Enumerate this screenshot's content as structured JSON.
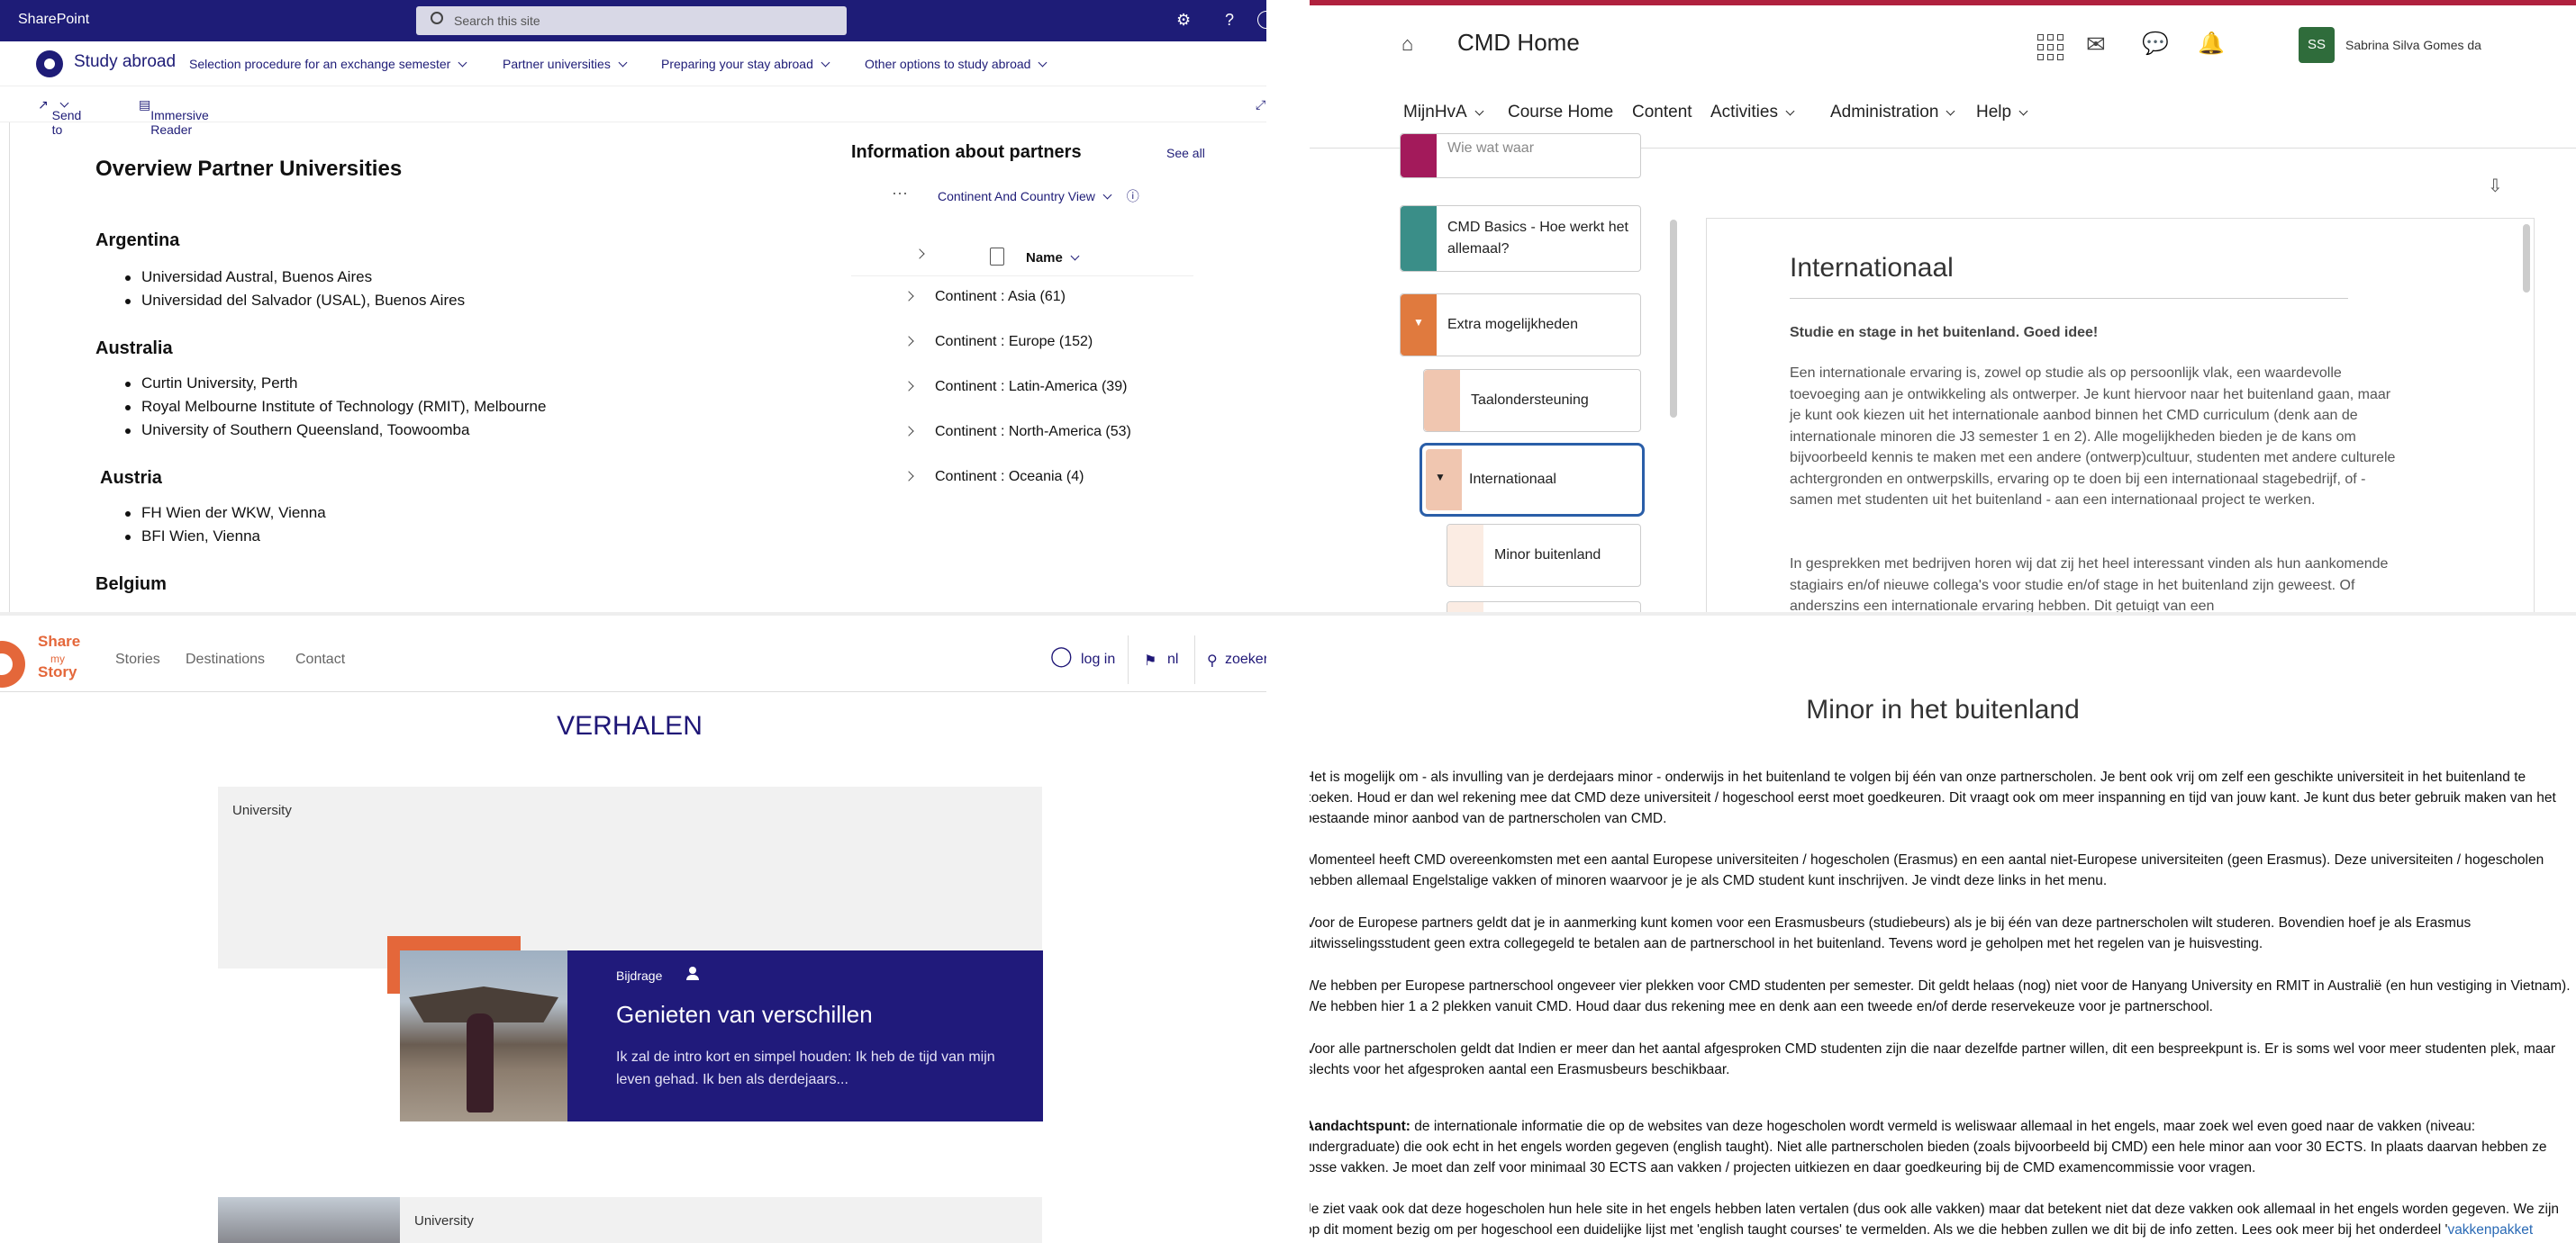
{
  "sharepoint": {
    "brand": "SharePoint",
    "search_placeholder": "Search this site",
    "site_name": "Study abroad",
    "nav": [
      "Selection procedure for an exchange semester",
      "Partner universities",
      "Preparing your stay abroad",
      "Other options to study abroad"
    ],
    "cmd": {
      "send_to": "Send to",
      "immersive_reader": "Immersive Reader"
    },
    "heading": "Overview Partner Universities",
    "countries": [
      {
        "name": "Argentina",
        "unis": [
          "Universidad Austral, Buenos Aires",
          "Universidad del Salvador (USAL), Buenos Aires"
        ]
      },
      {
        "name": "Australia",
        "unis": [
          "Curtin University, Perth",
          "Royal Melbourne Institute of Technology (RMIT), Melbourne",
          "University of Southern Queensland, Toowoomba"
        ]
      },
      {
        "name": "Austria",
        "unis": [
          "FH Wien der WKW, Vienna",
          "BFI Wien, Vienna"
        ]
      },
      {
        "name": "Belgium",
        "unis": []
      }
    ],
    "partners": {
      "title": "Information about partners",
      "see_all": "See all",
      "view": "Continent And Country View",
      "name_header": "Name",
      "groups": [
        "Continent : Asia (61)",
        "Continent : Europe (152)",
        "Continent : Latin-America (39)",
        "Continent : North-America (53)",
        "Continent : Oceania (4)"
      ]
    },
    "colors": {
      "suite_bar": "#1e1c77"
    }
  },
  "cmd": {
    "title": "CMD Home",
    "avatar": "SS",
    "user": "Sabrina Silva Gomes da",
    "nav": [
      "MijnHvA",
      "Course Home",
      "Content",
      "Activities",
      "Administration",
      "Help"
    ],
    "sidebar": {
      "partial_top": "Wie wat waar",
      "basics": "CMD Basics - Hoe werkt het allemaal?",
      "extra": "Extra mogelijkheden",
      "taal": "Taalondersteuning",
      "internationaal": "Internationaal",
      "minor": "Minor buitenland"
    },
    "doc": {
      "heading": "Internationaal",
      "lead": "Studie en stage in het buitenland. Goed idee!",
      "p1": "Een internationale ervaring is, zowel op studie als op persoonlijk vlak, een waardevolle toevoeging aan je ontwikkeling als ontwerper. Je kunt hiervoor naar het buitenland gaan, maar je kunt ook kiezen uit het internationale aanbod binnen het CMD curriculum (denk aan de internationale minoren die J3 semester 1 en 2). Alle mogelijkheden bieden je de kans om bijvoorbeeld kennis te maken met een andere (ontwerp)cultuur, studenten met andere culturele achtergronden en ontwerpskills, ervaring op te doen bij een internationaal stagebedrijf, of - samen met studenten uit het buitenland - aan een internationaal project te werken.",
      "p2": "In gesprekken met bedrijven horen wij dat zij het heel interessant vinden als hun aankomende stagiairs en/of nieuwe collega's voor studie en/of stage in het buitenland zijn geweest. Of anderszins een internationale ervaring hebben. Dit getuigt van een"
    },
    "colors": {
      "brand_bar": "#b0213e",
      "avatar": "#2f6c3b",
      "selected_border": "#2a5ea8"
    }
  },
  "story": {
    "logo": [
      "Share",
      "my",
      "Story"
    ],
    "nav": [
      "Stories",
      "Destinations",
      "Contact"
    ],
    "login": "log in",
    "lang": "nl",
    "search": "zoeker",
    "title": "VERHALEN",
    "card1": {
      "category": "University",
      "tag": "Bijdrage",
      "headline": "Genieten van verschillen",
      "teaser": "Ik zal de intro kort en simpel houden: Ik heb de tijd van mijn leven gehad. Ik ben als derdejaars..."
    },
    "card2": {
      "category": "University"
    },
    "colors": {
      "brand": "#201a7b",
      "accent": "#e4673a"
    }
  },
  "minor": {
    "title": "Minor in het buitenland",
    "p1": "Het is mogelijk om - als invulling van je derdejaars minor - onderwijs in het buitenland te volgen bij één van onze partnerscholen. Je bent ook vrij om zelf een geschikte universiteit in het buitenland te zoeken. Houd er dan wel rekening mee dat CMD deze universiteit / hogeschool eerst moet goedkeuren. Dit vraagt ook om meer inspanning en tijd van jouw kant. Je kunt dus beter gebruik maken van het bestaande minor aanbod van de partnerscholen van CMD.",
    "p2": "Momenteel heeft CMD overeenkomsten met een aantal Europese universiteiten / hogescholen (Erasmus) en een aantal niet-Europese universiteiten (geen Erasmus). Deze universiteiten / hogescholen hebben allemaal Engelstalige vakken of minoren waarvoor je je als CMD student kunt inschrijven. Je vindt deze links in het menu.",
    "p3": "Voor de Europese partners geldt dat je in aanmerking kunt komen voor een Erasmusbeurs (studiebeurs) als je bij één van deze partnerscholen wilt studeren. Bovendien hoef je als Erasmus uitwisselingsstudent geen extra collegegeld te betalen aan de partnerschool in het buitenland. Tevens word je geholpen met het regelen van je huisvesting.",
    "p4": "We hebben per Europese partnerschool ongeveer vier plekken voor CMD studenten per semester. Dit geldt helaas (nog) niet voor de Hanyang University en RMIT in Australië (en hun vestiging in Vietnam). We hebben hier 1 a 2 plekken vanuit CMD. Houd daar dus rekening mee en denk aan een tweede en/of derde reservekeuze voor je partnerschool.",
    "p5": "Voor alle partnerscholen geldt dat Indien er meer dan het aantal afgesproken CMD studenten zijn die naar dezelfde partner willen, dit een bespreekpunt is. Er is soms wel voor meer studenten plek, maar slechts voor het afgesproken aantal een Erasmusbeurs beschikbaar.",
    "p6_label": "Aandachtspunt:",
    "p6": " de internationale informatie die op de websites van deze hogescholen wordt vermeld is weliswaar allemaal in het engels, maar zoek wel even goed naar de vakken (niveau: undergraduate) die ook echt in het engels worden gegeven (english taught). Niet alle partnerscholen bieden (zoals bijvoorbeeld bij CMD) een hele minor aan voor 30 ECTS. In plaats daarvan hebben ze losse vakken. Je moet dan zelf voor minimaal 30 ECTS aan vakken / projecten uitkiezen en daar goedkeuring bij de CMD examencommissie voor vragen.",
    "p7": "Je ziet vaak ook dat deze hogescholen hun hele site in het engels hebben laten vertalen (dus ook alle vakken) maar dat betekent niet dat deze vakken ook allemaal in het engels worden gegeven. We zijn op dit moment bezig om per hogeschool een duidelijke lijst met 'english taught courses' te vermelden. Als we die hebben zullen we dit bij de info zetten. Lees ook meer bij het onderdeel '",
    "p7_link": "vakkenpakket"
  }
}
